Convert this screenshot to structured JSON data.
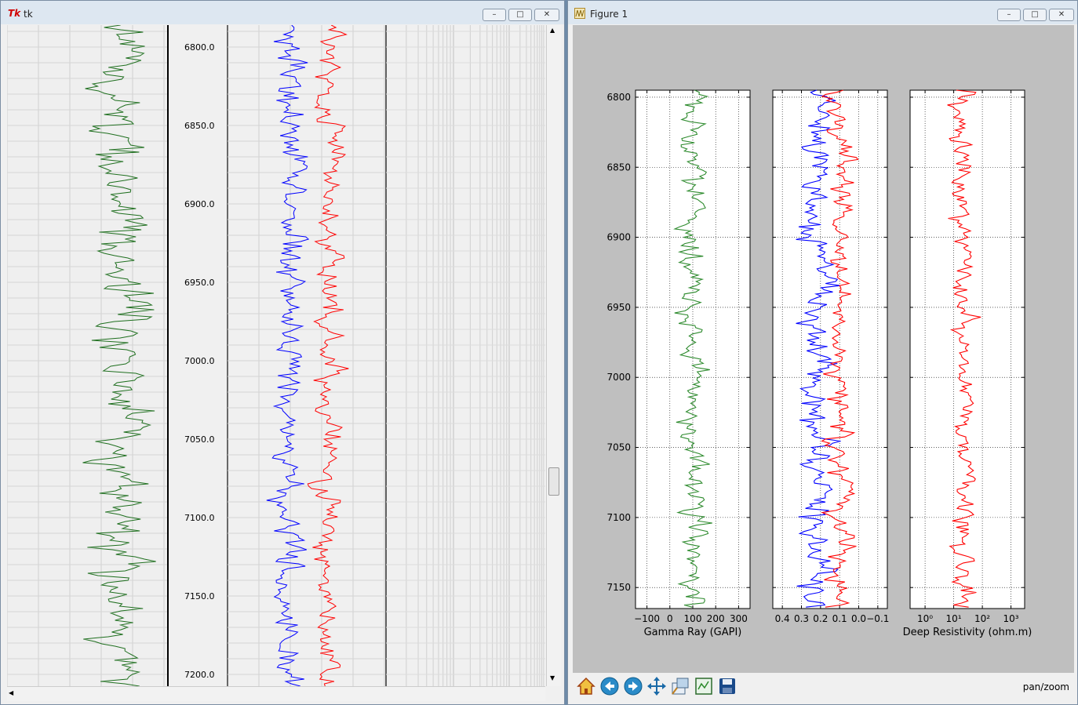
{
  "tk_window": {
    "title": "tk",
    "depth_labels": [
      "6800.0",
      "6850.0",
      "6900.0",
      "6950.0",
      "7000.0",
      "7050.0",
      "7100.0",
      "7150.0",
      "7200.0"
    ],
    "controls": {
      "minimize": "–",
      "maximize": "□",
      "close": "✕"
    }
  },
  "figure_window": {
    "title": "Figure 1",
    "status": "pan/zoom",
    "toolbar": [
      "home-icon",
      "back-icon",
      "forward-icon",
      "pan-icon",
      "zoom-icon",
      "subplots-icon",
      "save-icon"
    ]
  },
  "chart_data": [
    {
      "type": "line",
      "xlabel": "Gamma Ray (GAPI)",
      "ylabel": "",
      "xlim": [
        -150,
        350
      ],
      "x_ticks": [
        "−100",
        "0",
        "100",
        "200",
        "300"
      ],
      "ylim": [
        7165,
        6795
      ],
      "y_ticks": [
        "6800",
        "6850",
        "6900",
        "6950",
        "7000",
        "7050",
        "7100",
        "7150"
      ],
      "grid": true,
      "series": [
        {
          "color": "#2e8b2e",
          "center": 100,
          "spread": 45
        }
      ]
    },
    {
      "type": "line",
      "xlabel": "",
      "ylabel": "",
      "xlim": [
        0.45,
        -0.15
      ],
      "x_ticks": [
        "0.4",
        "0.3",
        "0.2",
        "0.1",
        "0.0",
        "−0.1"
      ],
      "ylim": [
        7165,
        6795
      ],
      "grid": true,
      "series": [
        {
          "color": "#0000ff",
          "center": 0.22,
          "spread": 0.07
        },
        {
          "color": "#ff0000",
          "center": 0.1,
          "spread": 0.05
        }
      ]
    },
    {
      "type": "line",
      "xlabel": "Deep Resistivity (ohm.m)",
      "ylabel": "",
      "xscale": "log",
      "xlim": [
        0.3,
        3000
      ],
      "x_ticks": [
        "10⁰",
        "10¹",
        "10²",
        "10³"
      ],
      "ylim": [
        7165,
        6795
      ],
      "grid": true,
      "series": [
        {
          "color": "#ff0000",
          "center": 20,
          "spread": 0.35
        }
      ]
    }
  ]
}
